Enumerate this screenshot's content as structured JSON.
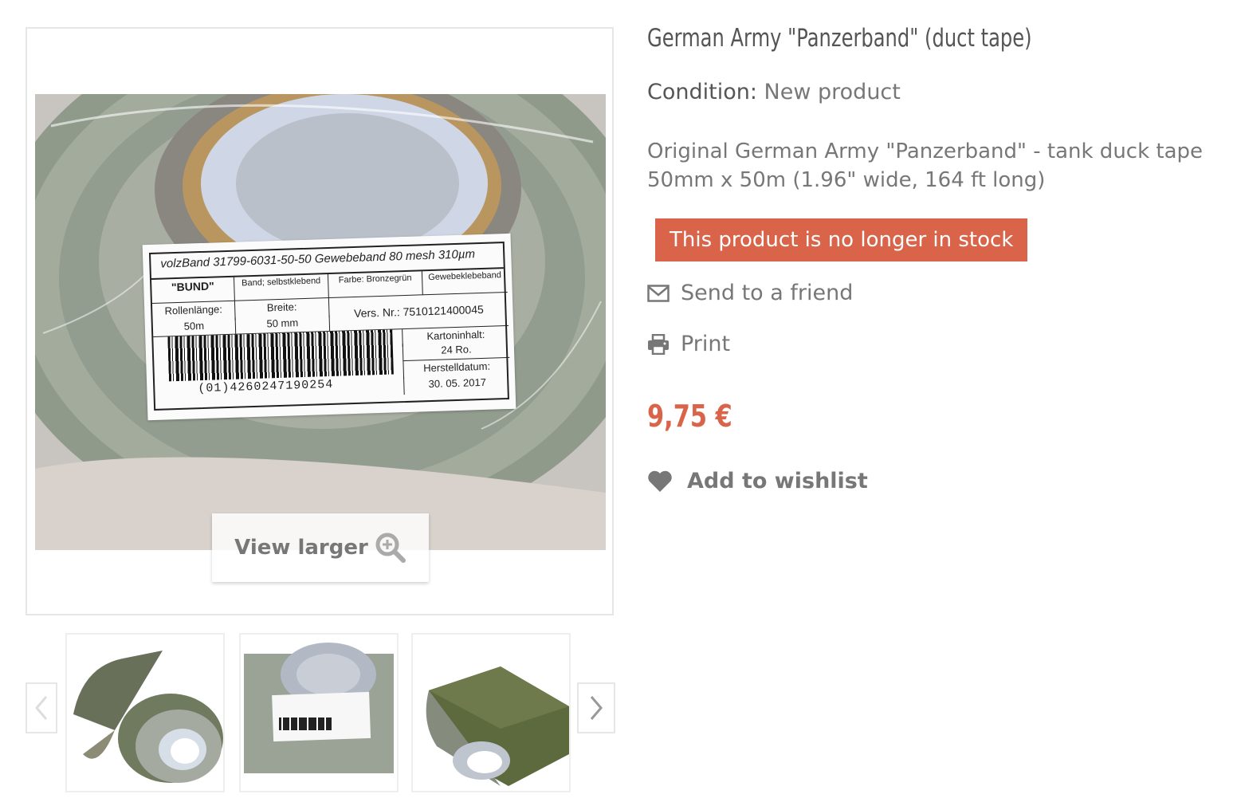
{
  "product": {
    "title": "German Army \"Panzerband\" (duct tape)",
    "condition_label": "Condition:",
    "condition_value": "New product",
    "description_line1": "Original German Army \"Panzerband\" - tank duck tape",
    "description_line2": "50mm x 50m (1.96\" wide, 164 ft long)",
    "stock_status": "This product is no longer in stock",
    "price": "9,75 €",
    "accent_color": "#d9644a"
  },
  "actions": {
    "send_to_friend": "Send to a friend",
    "print": "Print",
    "add_to_wishlist": "Add to wishlist"
  },
  "gallery": {
    "view_larger": "View larger",
    "thumbnails": [
      "tape-roll-unrolled",
      "tape-roll-label",
      "tape-roll-side"
    ]
  },
  "tape_label": {
    "header": "volzBand 31799-6031-50-50  Gewebeband 80 mesh 310µm",
    "bund": "\"BUND\"",
    "band": "Band; selbstklebend",
    "farbe": "Farbe: Bronzegrün",
    "gewebe": "Gewebeklebeband",
    "rollenlaenge": "Rollenlänge:",
    "rollenlaenge_value": "50m",
    "breite": "Breite:",
    "breite_value": "50 mm",
    "vers_nr": "Vers. Nr.: 7510121400045",
    "karton": "Kartoninhalt:",
    "karton_value": "24 Ro.",
    "herstell": "Herstelldatum:",
    "herstell_value": "30. 05. 2017",
    "barcode_number": "(01)4260247190254"
  }
}
